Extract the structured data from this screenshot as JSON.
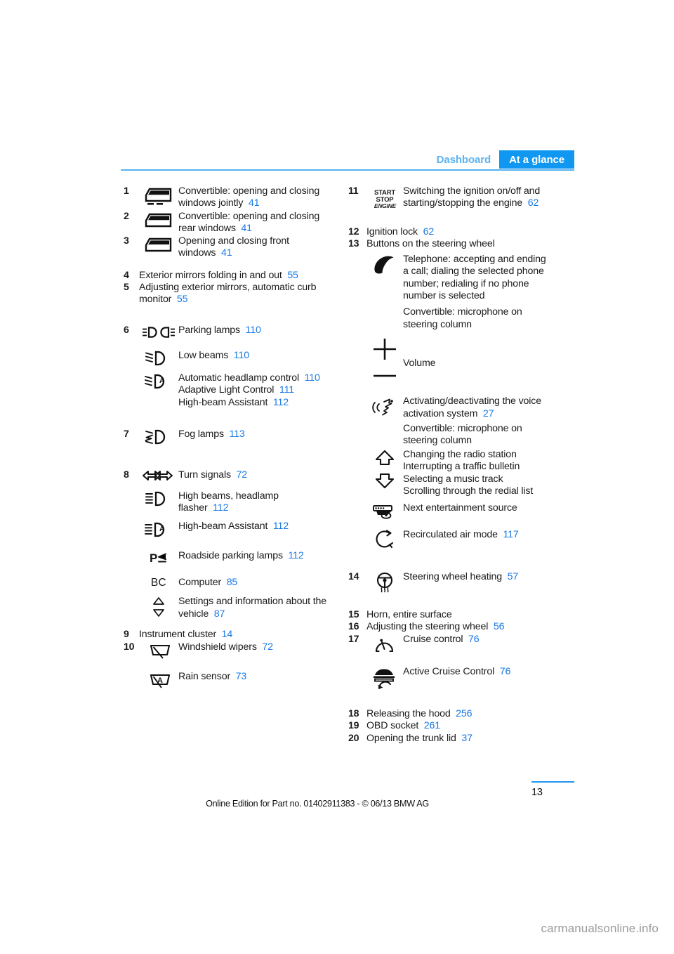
{
  "header": {
    "breadcrumb_inactive": "Dashboard",
    "breadcrumb_active": "At a glance",
    "accent_color": "#0f97f2",
    "muted_accent_color": "#5cb3f0"
  },
  "link_color": "#1779e4",
  "left_column": {
    "items": [
      {
        "number": "1",
        "icon": "convertible-window-all-icon",
        "lines": [
          {
            "text": "Convertible: opening and closing"
          },
          {
            "text": "windows jointly",
            "page": "41"
          }
        ]
      },
      {
        "number": "2",
        "icon": "convertible-window-rear-icon",
        "lines": [
          {
            "text": "Convertible: opening and closing"
          },
          {
            "text": "rear windows",
            "page": "41"
          }
        ]
      },
      {
        "number": "3",
        "icon": "window-front-icon",
        "lines": [
          {
            "text": "Opening and closing front"
          },
          {
            "text": "windows",
            "page": "41"
          }
        ]
      },
      {
        "number": "4",
        "icon": null,
        "lines": [
          {
            "text": "Exterior mirrors folding in and out",
            "page": "55"
          }
        ]
      },
      {
        "number": "5",
        "icon": null,
        "lines": [
          {
            "text": "Adjusting exterior mirrors, automatic curb"
          },
          {
            "text": "monitor",
            "page": "55"
          }
        ]
      },
      {
        "number": "6",
        "icon": "parking-lamps-icon",
        "lines": [
          {
            "text": "Parking lamps",
            "page": "110"
          }
        ]
      },
      {
        "number": null,
        "icon": "low-beams-icon",
        "lines": [
          {
            "text": "Low beams",
            "page": "110"
          }
        ]
      },
      {
        "number": null,
        "icon": "automatic-headlamp-control-icon",
        "lines": [
          {
            "text": "Automatic headlamp control",
            "page": "110"
          },
          {
            "text": "Adaptive Light Control",
            "page": "111"
          },
          {
            "text": "High-beam Assistant",
            "page": "112"
          }
        ]
      },
      {
        "number": "7",
        "icon": "fog-lamps-icon",
        "lines": [
          {
            "text": "Fog lamps",
            "page": "113"
          }
        ]
      },
      {
        "number": "8",
        "icon": "turn-signals-icon",
        "lines": [
          {
            "text": "Turn signals",
            "page": "72"
          }
        ]
      },
      {
        "number": null,
        "icon": "high-beams-icon",
        "lines": [
          {
            "text": "High beams, headlamp"
          },
          {
            "text": "flasher",
            "page": "112"
          }
        ]
      },
      {
        "number": null,
        "icon": "high-beam-assistant-icon",
        "lines": [
          {
            "text": "High-beam Assistant",
            "page": "112"
          }
        ]
      },
      {
        "number": null,
        "icon": "roadside-parking-lamps-icon",
        "lines": [
          {
            "text": "Roadside parking lamps",
            "page": "112"
          }
        ]
      },
      {
        "number": null,
        "icon": "bc-computer-icon",
        "lines": [
          {
            "text": "Computer",
            "page": "85"
          }
        ]
      },
      {
        "number": null,
        "icon": "up-down-triangles-icon",
        "lines": [
          {
            "text": "Settings and information about the"
          },
          {
            "text": "vehicle",
            "page": "87"
          }
        ]
      },
      {
        "number": "9",
        "icon": null,
        "lines": [
          {
            "text": "Instrument cluster",
            "page": "14"
          }
        ]
      },
      {
        "number": "10",
        "icon": "windshield-wipers-icon",
        "lines": [
          {
            "text": "Windshield wipers",
            "page": "72"
          }
        ]
      },
      {
        "number": null,
        "icon": "rain-sensor-icon",
        "lines": [
          {
            "text": "Rain sensor",
            "page": "73"
          }
        ]
      }
    ]
  },
  "right_column": {
    "items": [
      {
        "number": "11",
        "icon": "start-stop-engine-icon",
        "icon_text": {
          "line1": "START",
          "line2": "STOP",
          "line3": "ENGINE"
        },
        "lines": [
          {
            "text": "Switching the ignition on/off and"
          },
          {
            "text": "starting/stopping the engine",
            "page": "62"
          }
        ]
      },
      {
        "number": "12",
        "icon": null,
        "lines": [
          {
            "text": "Ignition lock",
            "page": "62"
          }
        ]
      },
      {
        "number": "13",
        "icon": null,
        "lines": [
          {
            "text": "Buttons on the steering wheel"
          }
        ]
      },
      {
        "number": null,
        "icon": "telephone-handset-icon",
        "lines": [
          {
            "text": "Telephone: accepting and ending"
          },
          {
            "text": "a call; dialing the selected phone"
          },
          {
            "text": "number; redialing if no phone"
          },
          {
            "text": "number is selected"
          }
        ]
      },
      {
        "number": null,
        "icon": null,
        "lines": [
          {
            "text": "Convertible: microphone on"
          },
          {
            "text": "steering column"
          }
        ]
      },
      {
        "number": null,
        "icon": "volume-plus-minus-icon",
        "lines": [
          {
            "text": "Volume"
          }
        ]
      },
      {
        "number": null,
        "icon": "voice-activation-icon",
        "lines": [
          {
            "text": "Activating/deactivating the voice"
          },
          {
            "text": "activation system",
            "page": "27"
          }
        ]
      },
      {
        "number": null,
        "icon": null,
        "lines": [
          {
            "text": "Convertible: microphone on"
          },
          {
            "text": "steering column"
          }
        ]
      },
      {
        "number": null,
        "icon": "arrow-up-down-icon",
        "lines": [
          {
            "text": "Changing the radio station"
          },
          {
            "text": "Interrupting a traffic bulletin"
          },
          {
            "text": "Selecting a music track"
          },
          {
            "text": "Scrolling through the redial list"
          }
        ]
      },
      {
        "number": null,
        "icon": "entertainment-source-icon",
        "lines": [
          {
            "text": "Next entertainment source"
          }
        ]
      },
      {
        "number": null,
        "icon": "recirculated-air-icon",
        "lines": [
          {
            "text": "Recirculated air mode",
            "page": "117"
          }
        ]
      },
      {
        "number": "14",
        "icon": "steering-wheel-heating-icon",
        "lines": [
          {
            "text": "Steering wheel heating",
            "page": "57"
          }
        ]
      },
      {
        "number": "15",
        "icon": null,
        "lines": [
          {
            "text": "Horn, entire surface"
          }
        ]
      },
      {
        "number": "16",
        "icon": null,
        "lines": [
          {
            "text": "Adjusting the steering wheel",
            "page": "56"
          }
        ]
      },
      {
        "number": "17",
        "icon": "cruise-control-icon",
        "lines": [
          {
            "text": "Cruise control",
            "page": "76"
          }
        ]
      },
      {
        "number": null,
        "icon": "active-cruise-control-icon",
        "lines": [
          {
            "text": "Active Cruise Control",
            "page": "76"
          }
        ]
      },
      {
        "number": "18",
        "icon": null,
        "lines": [
          {
            "text": "Releasing the hood",
            "page": "256"
          }
        ]
      },
      {
        "number": "19",
        "icon": null,
        "lines": [
          {
            "text": "OBD socket",
            "page": "261"
          }
        ]
      },
      {
        "number": "20",
        "icon": null,
        "lines": [
          {
            "text": "Opening the trunk lid",
            "page": "37"
          }
        ]
      }
    ]
  },
  "footer": {
    "edition_note": "Online Edition for Part no. 01402911383 - © 06/13 BMW AG",
    "page_number": "13",
    "watermark": "carmanualsonline.info"
  }
}
